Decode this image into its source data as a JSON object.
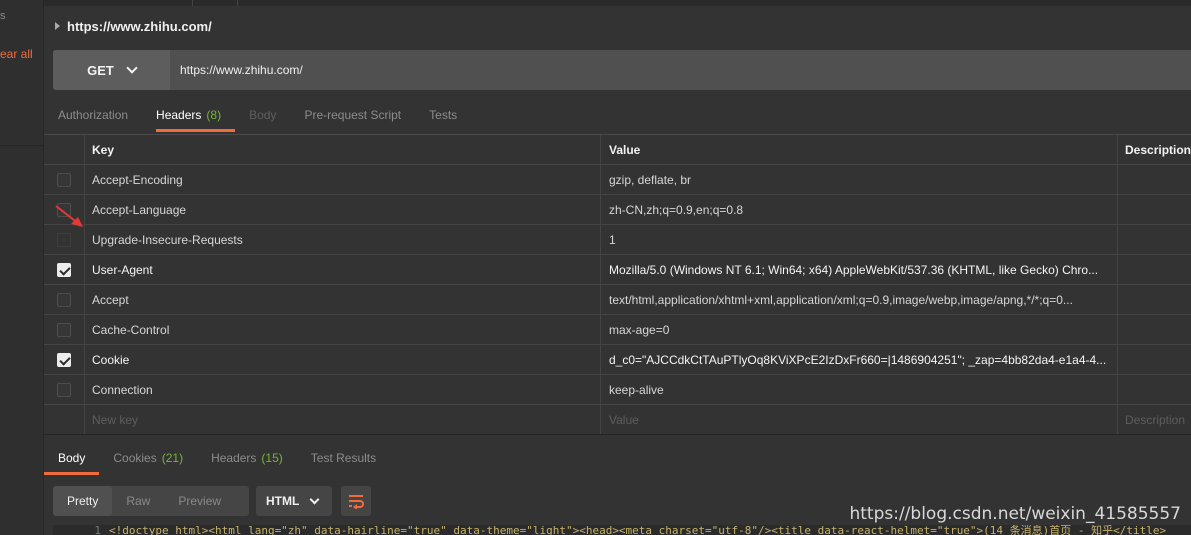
{
  "sidebar": {
    "fragment_top": "s",
    "clear_all": "ear all"
  },
  "request": {
    "title": "https://www.zhihu.com/",
    "method": "GET",
    "url": "https://www.zhihu.com/"
  },
  "request_tabs": [
    {
      "label": "Authorization",
      "state": "normal"
    },
    {
      "label": "Headers",
      "count": "(8)",
      "state": "active"
    },
    {
      "label": "Body",
      "state": "disabled"
    },
    {
      "label": "Pre-request Script",
      "state": "normal"
    },
    {
      "label": "Tests",
      "state": "normal"
    }
  ],
  "headers_table": {
    "columns": {
      "key": "Key",
      "value": "Value",
      "description": "Description"
    },
    "rows": [
      {
        "key": "Accept-Encoding",
        "value": "gzip, deflate, br",
        "checked": false
      },
      {
        "key": "Accept-Language",
        "value": "zh-CN,zh;q=0.9,en;q=0.8",
        "checked": false
      },
      {
        "key": "Upgrade-Insecure-Requests",
        "value": "1",
        "checked": false
      },
      {
        "key": "User-Agent",
        "value": "Mozilla/5.0 (Windows NT 6.1; Win64; x64) AppleWebKit/537.36 (KHTML, like Gecko) Chro...",
        "checked": true
      },
      {
        "key": "Accept",
        "value": "text/html,application/xhtml+xml,application/xml;q=0.9,image/webp,image/apng,*/*;q=0...",
        "checked": false
      },
      {
        "key": "Cache-Control",
        "value": "max-age=0",
        "checked": false
      },
      {
        "key": "Cookie",
        "value": "d_c0=\"AJCCdkCtTAuPTlyOq8KViXPcE2IzDxFr660=|1486904251\"; _zap=4bb82da4-e1a4-4...",
        "checked": true
      },
      {
        "key": "Connection",
        "value": "keep-alive",
        "checked": false
      }
    ],
    "placeholder": {
      "key": "New key",
      "value": "Value",
      "description": "Description"
    }
  },
  "response_tabs": [
    {
      "label": "Body",
      "state": "active"
    },
    {
      "label": "Cookies",
      "count": "(21)",
      "state": "normal"
    },
    {
      "label": "Headers",
      "count": "(15)",
      "state": "normal"
    },
    {
      "label": "Test Results",
      "state": "normal"
    }
  ],
  "view_modes": {
    "pretty": "Pretty",
    "raw": "Raw",
    "preview": "Preview"
  },
  "format": "HTML",
  "code_line": {
    "number": "1",
    "text": "<!doctype html><html lang=\"zh\" data-hairline=\"true\" data-theme=\"light\"><head><meta charset=\"utf-8\"/><title data-react-helmet=\"true\">(14 条消息)首页 - 知乎</title>"
  },
  "watermark": "https://blog.csdn.net/weixin_41585557",
  "colors": {
    "accent": "#f26b3a",
    "count_green": "#74b536",
    "background": "#333333",
    "annotation_arrow": "#e53935"
  }
}
